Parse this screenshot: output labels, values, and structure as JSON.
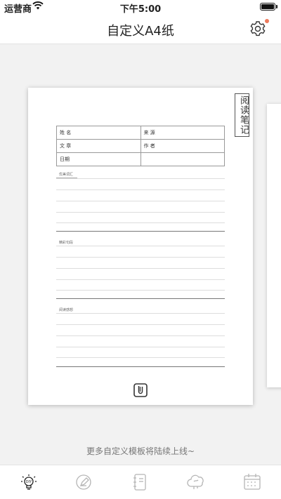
{
  "status_bar": {
    "carrier": "运营商",
    "time": "下午5:00"
  },
  "nav": {
    "title": "自定义A4纸",
    "settings_icon": "gear-icon"
  },
  "template": {
    "vertical_tag": "阅读笔记",
    "table": {
      "name_label": "姓 名",
      "source_label": "来 源",
      "article_label": "文 章",
      "author_label": "作 者",
      "date_label": "日期"
    },
    "sections": [
      "优美词汇",
      "精彩句段",
      "阅读感想"
    ],
    "bottom_icon": "paperclip-icon"
  },
  "footer_note": "更多自定义模板将陆续上线~",
  "tabs": [
    {
      "name": "diy-lightbulb-icon",
      "active": true
    },
    {
      "name": "pen-icon",
      "active": false
    },
    {
      "name": "notebook-icon",
      "active": false
    },
    {
      "name": "brain-cloud-icon",
      "active": false
    },
    {
      "name": "calendar-icon",
      "active": false
    }
  ],
  "colors": {
    "accent_dot": "#ee7a5c",
    "tab_inactive": "#b5b5b5",
    "tab_active": "#222222"
  }
}
